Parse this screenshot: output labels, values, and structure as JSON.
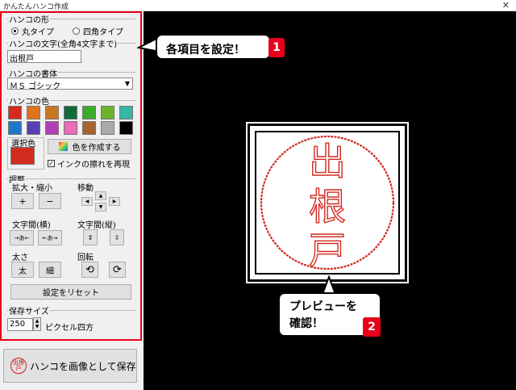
{
  "window": {
    "title": "かんたんハンコ作成",
    "close": "✕"
  },
  "shape": {
    "label": "ハンコの形",
    "options": [
      "丸タイプ",
      "四角タイプ"
    ],
    "selected": 0
  },
  "text": {
    "label": "ハンコの文字(全角4文字まで)",
    "value": "出根戸"
  },
  "font": {
    "label": "ハンコの書体",
    "value": "ＭＳ ゴシック"
  },
  "color": {
    "label": "ハンコの色",
    "swatches": [
      "#d22b20",
      "#e0721b",
      "#c8781e",
      "#106b38",
      "#3cab2d",
      "#6bb52a",
      "#37b6a4",
      "#1f78c8",
      "#5b3fb0",
      "#b03fb5",
      "#f06ab8",
      "#a86330",
      "#aaaaaa",
      "#000000"
    ],
    "selected_label": "選択色",
    "selected_color": "#d22b20",
    "create_button": "色を作成する",
    "smear_label": "インクの擦れを再現",
    "smear_checked": true
  },
  "adjust": {
    "label": "調整",
    "zoom_label": "拡大・縮小",
    "zoom_in": "+",
    "zoom_out": "−",
    "move_label": "移動",
    "hspacing_label": "文字間(横)",
    "vspacing_label": "文字間(縦)",
    "hs_narrow": "→あ←",
    "hs_wide": "←あ→",
    "weight_label": "太さ",
    "weight_bold": "太",
    "weight_thin": "細",
    "rotate_label": "回転",
    "reset_button": "設定をリセット"
  },
  "save_size": {
    "label": "保存サイズ",
    "value": "250",
    "unit": "ピクセル四方"
  },
  "save_button": {
    "label": "ハンコを画像として保存",
    "seal_text": "出根戸"
  },
  "stamp": {
    "chars": [
      "出",
      "根",
      "戸"
    ],
    "color": "#d22b20"
  },
  "callouts": {
    "one": {
      "text": "各項目を設定！",
      "badge": "1"
    },
    "two": {
      "line1": "プレビューを",
      "line2": "確認！",
      "badge": "2"
    }
  }
}
